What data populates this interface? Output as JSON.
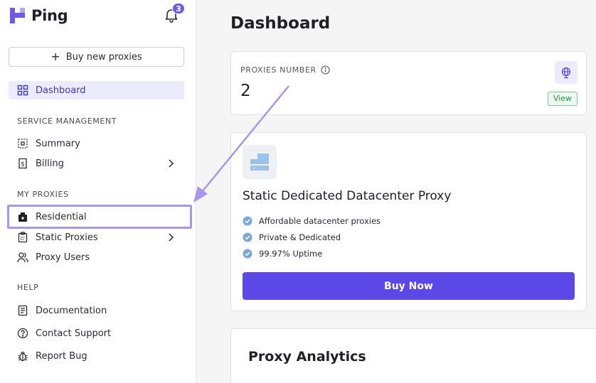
{
  "brand": {
    "name": "Ping",
    "accent": "#5b48e6"
  },
  "notifications": {
    "count": "3"
  },
  "sidebar": {
    "buy_button_label": "Buy new proxies",
    "items": {
      "dashboard": "Dashboard",
      "summary": "Summary",
      "billing": "Billing",
      "residential": "Residential",
      "static_proxies": "Static Proxies",
      "proxy_users": "Proxy Users",
      "documentation": "Documentation",
      "contact_support": "Contact Support",
      "report_bug": "Report Bug"
    },
    "sections": {
      "service_management": "SERVICE MANAGEMENT",
      "my_proxies": "MY PROXIES",
      "help": "HELP"
    },
    "highlighted_item": "Residential"
  },
  "main": {
    "title": "Dashboard",
    "proxies_card": {
      "label": "PROXIES NUMBER",
      "value": "2",
      "view_label": "View"
    },
    "product_card": {
      "title": "Static Dedicated Datacenter Proxy",
      "features": [
        "Affordable datacenter proxies",
        "Private & Dedicated",
        "99.97% Uptime"
      ],
      "cta_label": "Buy Now"
    },
    "analytics": {
      "title": "Proxy Analytics"
    }
  },
  "icons": {
    "logo": "ping-logo-icon",
    "bell": "bell-icon",
    "plus": "plus-icon",
    "dashboard": "grid-icon",
    "summary": "summary-icon",
    "billing": "receipt-icon",
    "residential": "house-icon",
    "static_proxies": "clipboard-icon",
    "proxy_users": "users-icon",
    "documentation": "book-icon",
    "contact_support": "help-circle-icon",
    "report_bug": "bug-icon",
    "globe": "globe-icon",
    "check": "check-circle-icon",
    "info": "info-icon"
  }
}
